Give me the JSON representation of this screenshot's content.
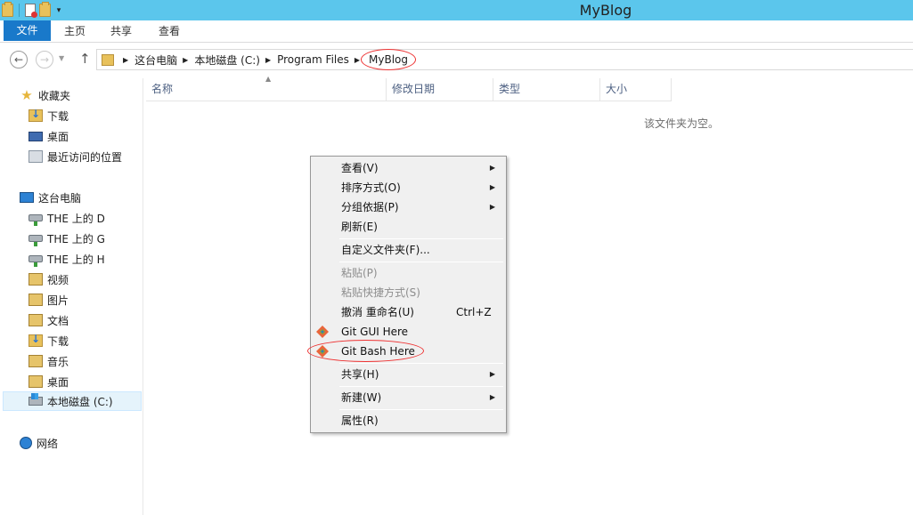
{
  "window": {
    "title": "MyBlog"
  },
  "ribbon": {
    "tabs": [
      {
        "label": "文件"
      },
      {
        "label": "主页"
      },
      {
        "label": "共享"
      },
      {
        "label": "查看"
      }
    ]
  },
  "address": {
    "crumbs": [
      "这台电脑",
      "本地磁盘 (C:)",
      "Program Files",
      "MyBlog"
    ]
  },
  "navpane": {
    "favorites": {
      "label": "收藏夹",
      "items": [
        "下载",
        "桌面",
        "最近访问的位置"
      ]
    },
    "computer": {
      "label": "这台电脑",
      "items": [
        "THE 上的 D",
        "THE 上的 G",
        "THE 上的 H",
        "视频",
        "图片",
        "文档",
        "下载",
        "音乐",
        "桌面",
        "本地磁盘 (C:)"
      ]
    },
    "network": {
      "label": "网络"
    }
  },
  "columns": [
    "名称",
    "修改日期",
    "类型",
    "大小"
  ],
  "content": {
    "empty_message": "该文件夹为空。"
  },
  "context_menu": {
    "items": [
      {
        "label": "查看(V)",
        "submenu": true,
        "disabled": false
      },
      {
        "label": "排序方式(O)",
        "submenu": true,
        "disabled": false
      },
      {
        "label": "分组依据(P)",
        "submenu": true,
        "disabled": false
      },
      {
        "label": "刷新(E)",
        "submenu": false,
        "disabled": false
      },
      {
        "label": "自定义文件夹(F)...",
        "submenu": false,
        "disabled": false
      },
      {
        "label": "粘贴(P)",
        "submenu": false,
        "disabled": true
      },
      {
        "label": "粘贴快捷方式(S)",
        "submenu": false,
        "disabled": true
      },
      {
        "label": "撤消 重命名(U)",
        "shortcut": "Ctrl+Z",
        "submenu": false,
        "disabled": false
      },
      {
        "label": "Git GUI Here",
        "icon": "git-icon",
        "submenu": false,
        "disabled": false
      },
      {
        "label": "Git Bash Here",
        "icon": "git-icon",
        "submenu": false,
        "disabled": false
      },
      {
        "label": "共享(H)",
        "submenu": true,
        "disabled": false
      },
      {
        "label": "新建(W)",
        "submenu": true,
        "disabled": false
      },
      {
        "label": "属性(R)",
        "submenu": false,
        "disabled": false
      }
    ]
  },
  "colors": {
    "titlebar": "#5bc6ec",
    "file_tab": "#1979ca",
    "annotation": "#e33333"
  }
}
